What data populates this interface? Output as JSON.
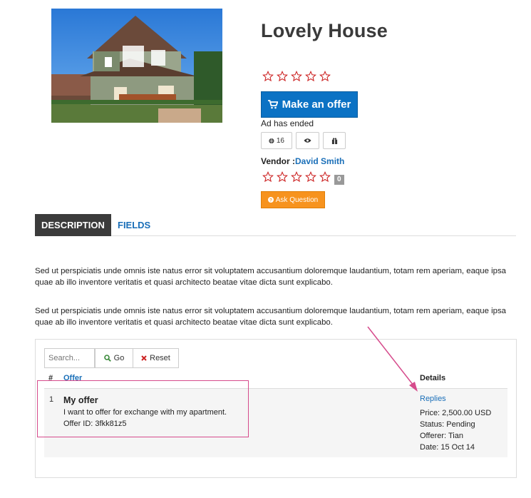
{
  "product": {
    "title": "Lovely House",
    "rating_stars": 0,
    "offer_button": "Make an offer",
    "ad_status": "Ad has ended",
    "views_count": "16",
    "vendor_label": "Vendor :",
    "vendor_name": "David Smith",
    "vendor_rating_count": "0",
    "ask_question": "Ask Question"
  },
  "tabs": [
    {
      "label": "DESCRIPTION"
    },
    {
      "label": "FIELDS"
    }
  ],
  "description": {
    "para1": "Sed ut perspiciatis unde omnis iste natus error sit voluptatem accusantium doloremque laudantium, totam rem aperiam, eaque ipsa quae ab illo inventore veritatis et quasi architecto beatae vitae dicta sunt explicabo.",
    "para2": "Sed ut perspiciatis unde omnis iste natus error sit voluptatem accusantium doloremque laudantium, totam rem aperiam, eaque ipsa quae ab illo inventore veritatis et quasi architecto beatae vitae dicta sunt explicabo."
  },
  "offers": {
    "search_placeholder": "Search...",
    "go_label": "Go",
    "reset_label": "Reset",
    "col_num": "#",
    "col_offer": "Offer",
    "col_details": "Details",
    "rows": [
      {
        "num": "1",
        "title": "My offer",
        "desc": "I want to offer for exchange with my apartment.",
        "offer_id": "Offer ID: 3fkk81z5",
        "replies": "Replies",
        "price": "Price: 2,500.00 USD",
        "status": "Status: Pending",
        "offerer": "Offerer: Tian",
        "date": "Date: 15 Oct 14"
      }
    ]
  },
  "colors": {
    "primary_button": "#0b72c4",
    "ask_button": "#f7931e",
    "link": "#1a6fb8",
    "star": "#cc2222",
    "annotation": "#d64b8c"
  }
}
